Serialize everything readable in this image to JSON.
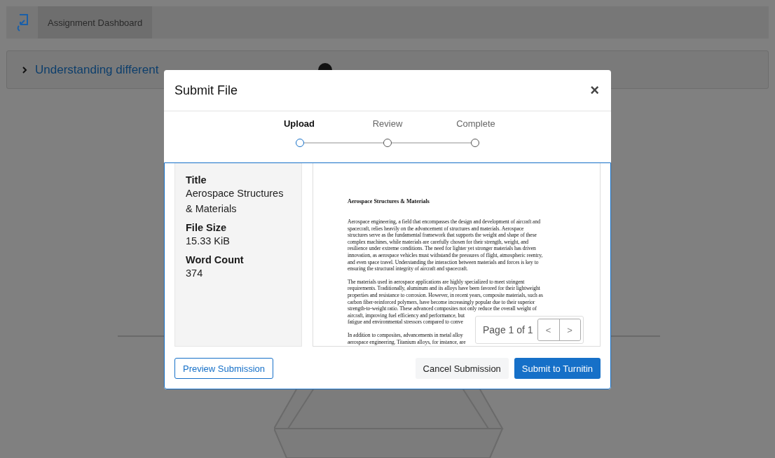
{
  "header": {
    "tab": "Assignment Dashboard"
  },
  "assignment": {
    "title": "Understanding different",
    "expanded": false
  },
  "dialog": {
    "title": "Submit File",
    "close": "×",
    "steps": [
      {
        "label": "Upload",
        "selected": true
      },
      {
        "label": "Review",
        "selected": false
      },
      {
        "label": "Complete",
        "selected": false
      }
    ],
    "details": [
      {
        "label": "Title",
        "value": "Aerospace Structures & Materials"
      },
      {
        "label": "File Size",
        "value": "15.33 KiB"
      },
      {
        "label": "Word Count",
        "value": "374"
      }
    ],
    "document": {
      "heading": "Aerospace Structures & Materials",
      "paragraphs": [
        [
          "Aerospace engineering, a field that encompasses the design and development of aircraft and",
          "spacecraft, relies heavily on the advancement of structures and materials. Aerospace",
          "structures serve as the fundamental framework that supports the weight and shape of these",
          "complex machines, while materials are carefully chosen for their strength, weight, and",
          "resilience under extreme conditions. The need for lighter yet stronger materials has driven",
          "innovation, as aerospace vehicles must withstand the pressures of flight, atmospheric reentry,",
          "and even space travel. Understanding the interaction between materials and forces is key to",
          "ensuring the structural integrity of aircraft and spacecraft."
        ],
        [
          "The materials used in aerospace applications are highly specialized to meet stringent",
          "requirements. Traditionally, aluminum and its alloys have been favored for their lightweight",
          "properties and resistance to corrosion. However, in recent years, composite materials, such as",
          "carbon fiber-reinforced polymers, have become increasingly popular due to their superior",
          "strength-to-weight ratio. These advanced composites not only reduce the overall weight of",
          "aircraft, improving fuel efficiency and performance, but",
          "fatigue and environmental stressors compared to conve"
        ],
        [
          "In addition to composites, advancements in metal alloy",
          "aerospace engineering. Titanium alloys, for instance, are"
        ]
      ]
    },
    "pager": {
      "label": "Page 1 of 1",
      "prev": "<",
      "next": ">"
    },
    "buttons": {
      "preview": "Preview Submission",
      "cancel": "Cancel Submission",
      "submit": "Submit to Turnitin"
    }
  }
}
